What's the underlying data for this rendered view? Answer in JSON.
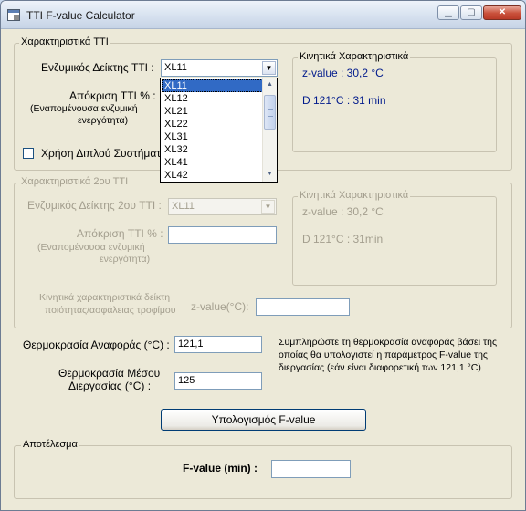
{
  "window": {
    "title": "TTI F-value Calculator"
  },
  "section1": {
    "title": "Χαρακτηριστικά TTI",
    "indicator_label": "Ενζυμικός Δείκτης TTI :",
    "indicator_value": "XL11",
    "response_label": "Απόκριση TTI % :",
    "response_sub1": "(Εναπομένουσα ενζυμική",
    "response_sub2": "ενεργότητα)",
    "dual_system_label": "Χρήση Διπλού Συστήματ",
    "kinetic": {
      "title": "Κινητικά Χαρακτηριστικά",
      "z_value": "z-value : 30,2 °C",
      "d_value": "D 121°C : 31 min"
    },
    "dropdown_options": [
      "XL11",
      "XL12",
      "XL21",
      "XL22",
      "XL31",
      "XL32",
      "XL41",
      "XL42"
    ]
  },
  "section2": {
    "title": "Χαρακτηριστικά 2ου TTI",
    "indicator_label": "Ενζυμικός Δείκτης 2ου TTI :",
    "indicator_value": "XL11",
    "response_label": "Απόκριση TTI % :",
    "response_sub1": "(Εναπομένουσα ενζυμική",
    "response_sub2": "ενεργότητα)",
    "kinetic": {
      "title": "Κινητικά Χαρακτηριστικά",
      "z_value": "z-value : 30,2 °C",
      "d_value": "D 121°C : 31min"
    },
    "quality_label1": "Κινητικά χαρακτηριστικά δείκτη",
    "quality_label2": "ποιότητας/ασφάλειας τροφίμου",
    "zvalue_label": "z-value(°C):"
  },
  "reference": {
    "temp_label": "Θερμοκρασία Αναφοράς (°C) :",
    "temp_value": "121,1",
    "info1": "Συμπληρώστε τη θερμοκρασία αναφοράς βάσει της",
    "info2": "οποίας θα υπολογιστεί η παράμετρος F-value της",
    "info3": "διεργασίας (εάν είναι διαφορετική των 121,1 °C)",
    "mean_label1": "Θερμοκρασία Μέσου",
    "mean_label2": "Διεργασίας (°C) :",
    "mean_value": "125"
  },
  "calculate_button": "Υπολογισμός F-value",
  "result": {
    "title": "Αποτέλεσμα",
    "fvalue_label": "F-value (min) :"
  }
}
